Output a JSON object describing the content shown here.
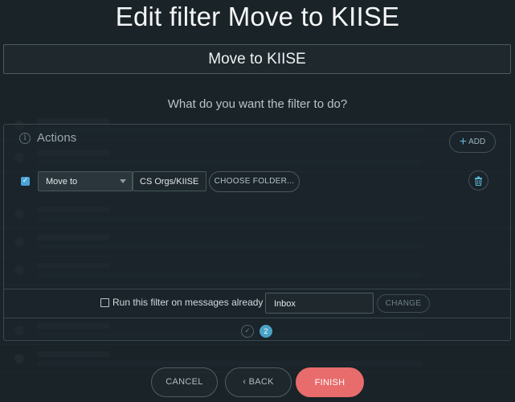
{
  "dialog": {
    "title": "Edit filter Move to KIISE",
    "filter_name_value": "Move to KIISE",
    "question": "What do you want the filter to do?"
  },
  "actions": {
    "label": "Actions",
    "add_label": "ADD",
    "rows": [
      {
        "checked": true,
        "action_type": "Move to",
        "folder": "CS Orgs/KIISE",
        "choose_folder_label": "CHOOSE FOLDER..."
      }
    ]
  },
  "run_existing": {
    "label": "Run this filter on messages already in:",
    "folder_value": "Inbox",
    "change_label": "CHANGE"
  },
  "steps": {
    "done_mark": "✓",
    "current": "2"
  },
  "footer": {
    "cancel_label": "CANCEL",
    "back_label": "‹ BACK",
    "finish_label": "FINISH"
  },
  "colors": {
    "accent": "#4aa3c7",
    "finish": "#e86c6c",
    "background": "#1f2a2f"
  }
}
